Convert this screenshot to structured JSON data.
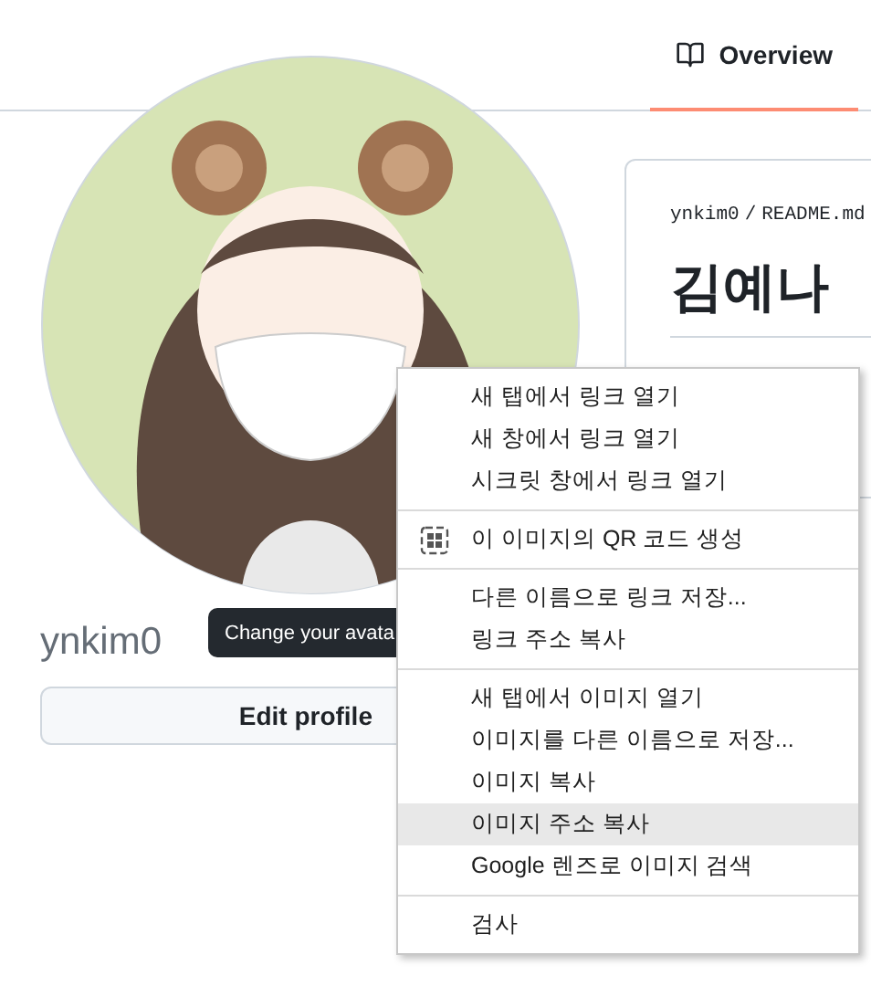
{
  "tabs": [
    {
      "label": "Overview",
      "selected": true
    }
  ],
  "profile": {
    "tooltip": "Change your avata",
    "username": "ynkim0",
    "edit_button": "Edit profile"
  },
  "readme": {
    "breadcrumb": [
      "ynkim0",
      "/",
      "README.md"
    ],
    "heading": "김예나"
  },
  "context_menu": {
    "groups": [
      [
        {
          "kind": "plain",
          "label": "새 탭에서 링크 열기",
          "selected": false
        },
        {
          "kind": "plain",
          "label": "새 창에서 링크 열기",
          "selected": false
        },
        {
          "kind": "plain",
          "label": "시크릿 창에서 링크 열기",
          "selected": false
        }
      ],
      [
        {
          "kind": "with_icon",
          "label": "이 이미지의 QR 코드 생성",
          "selected": false
        }
      ],
      [
        {
          "kind": "plain",
          "label": "다른 이름으로 링크 저장...",
          "selected": false
        },
        {
          "kind": "plain",
          "label": "링크 주소 복사",
          "selected": false
        }
      ],
      [
        {
          "kind": "plain",
          "label": "새 탭에서 이미지 열기",
          "selected": false
        },
        {
          "kind": "plain",
          "label": "이미지를 다른 이름으로 저장...",
          "selected": false
        },
        {
          "kind": "plain",
          "label": "이미지 복사",
          "selected": false
        },
        {
          "kind": "plain",
          "label": "이미지 주소 복사",
          "selected": true
        },
        {
          "kind": "plain",
          "label": "Google 렌즈로 이미지 검색",
          "selected": false
        }
      ],
      [
        {
          "kind": "plain",
          "label": "검사",
          "selected": false
        }
      ]
    ]
  }
}
